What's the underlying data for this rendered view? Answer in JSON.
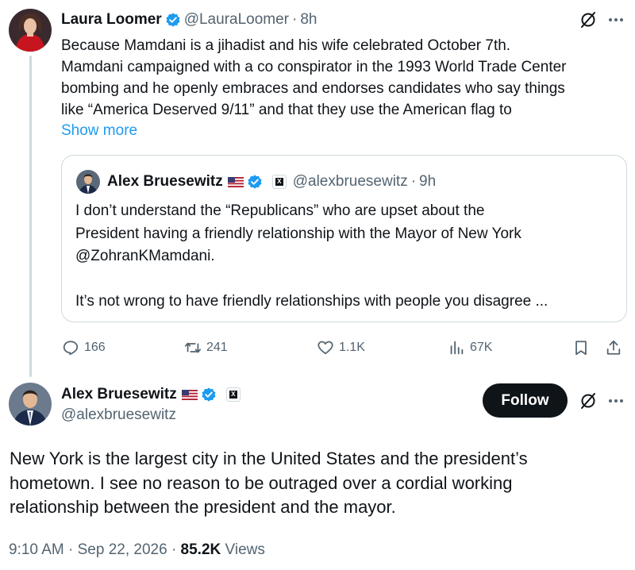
{
  "reply_tweet": {
    "display_name": "Laura Loomer",
    "handle": "@LauraLoomer",
    "separator": "·",
    "time": "8h",
    "text_lines": [
      "Because Mamdani is a jihadist and his wife celebrated October 7th.",
      "Mamdani campaigned with a co conspirator in the 1993 World Trade Center",
      "bombing and he openly embraces and endorses candidates who say things",
      "like “America Deserved 9/11” and that they use the American flag to"
    ],
    "show_more": "Show more",
    "quoted_tweet": {
      "display_name": "Alex Bruesewitz",
      "handle": "@alexbruesewitz",
      "separator": "·",
      "time": "9h",
      "text_lines": [
        "I don’t understand the “Republicans” who are upset about the",
        "President having a friendly relationship with the Mayor of New York",
        "@ZohranKMamdani."
      ],
      "text_lines_2": [
        "It’s not wrong to have friendly relationships with people you disagree ..."
      ]
    },
    "stats": {
      "replies": "166",
      "retweets": "241",
      "likes": "1.1K",
      "views": "67K"
    }
  },
  "main_tweet": {
    "display_name": "Alex Bruesewitz",
    "handle": "@alexbruesewitz",
    "follow_label": "Follow",
    "text_lines": [
      "New York is the largest city in the United States and the president’s",
      "hometown. I see no reason to be outraged over a cordial working",
      "relationship between the president and the mayor."
    ],
    "time": "9:10 AM",
    "separator": "·",
    "date": "Sep 22, 2026",
    "views_count": "85.2K",
    "views_label": "Views"
  },
  "colors": {
    "accent": "#1d9bf0",
    "text": "#0f1419",
    "muted": "#536471",
    "border": "#cfd9de"
  },
  "icons": [
    "verified-badge-icon",
    "us-flag-icon",
    "x-affiliate-badge-icon",
    "grok-icon",
    "more-icon",
    "reply-icon",
    "retweet-icon",
    "like-icon",
    "views-icon",
    "bookmark-icon",
    "share-icon"
  ]
}
